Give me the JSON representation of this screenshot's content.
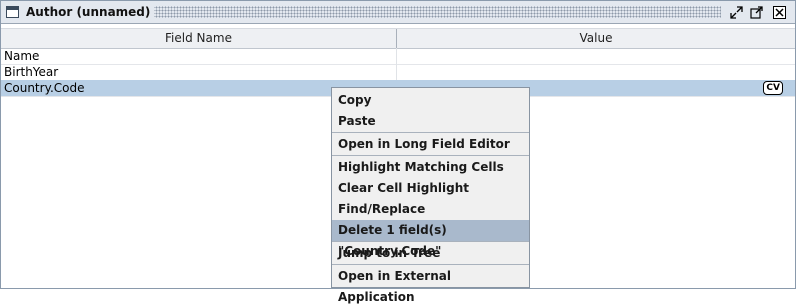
{
  "window": {
    "title": "Author (unnamed)",
    "buttons": [
      "restore-icon",
      "maximize-icon",
      "close-icon"
    ]
  },
  "table": {
    "columns": [
      "Field Name",
      "Value"
    ],
    "rows": [
      {
        "field": "Name",
        "value": ""
      },
      {
        "field": "BirthYear",
        "value": ""
      },
      {
        "field": "Country.Code",
        "value": "",
        "badge": "CV",
        "selected": true
      }
    ]
  },
  "context_menu": {
    "items": [
      "Copy",
      "Paste",
      "Open in Long Field Editor",
      "Highlight Matching Cells",
      "Clear Cell Highlight",
      "Find/Replace",
      "Delete 1 field(s) \"Country.Code\"",
      "Jump to in Tree",
      "Open in External Application"
    ],
    "highlighted": "Delete 1 field(s) \"Country.Code\""
  },
  "colors": {
    "selection": "#b8cfe5",
    "menu_highlight": "#a9b9cc",
    "titlebar": "#e3e8ef"
  }
}
